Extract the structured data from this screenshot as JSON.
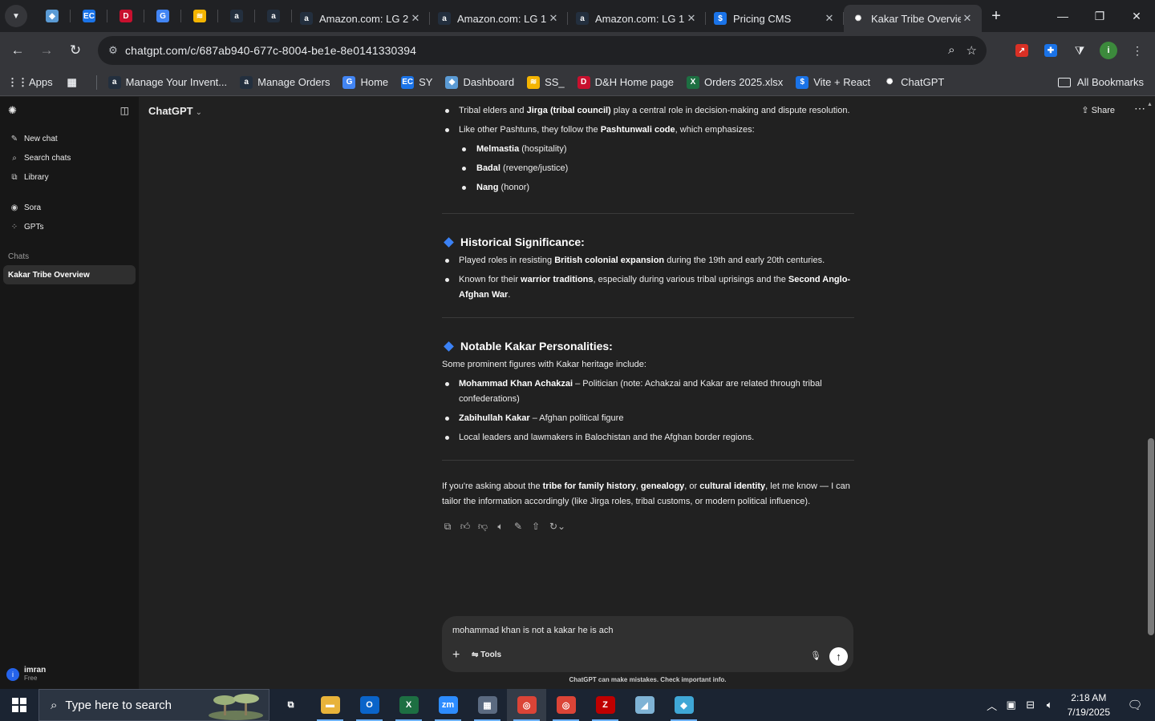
{
  "browser": {
    "pinned_tabs": [
      {
        "icon": "diamond-app-icon",
        "color": "#5b9bd5",
        "glyph": "◆"
      },
      {
        "icon": "ec-icon",
        "color": "#1a73e8",
        "glyph": "EC"
      },
      {
        "icon": "dh-icon",
        "color": "#c8102e",
        "glyph": "D"
      },
      {
        "icon": "g-blue-icon",
        "color": "#4285f4",
        "glyph": "G"
      },
      {
        "icon": "stack-icon",
        "color": "#f4b400",
        "glyph": "≋"
      },
      {
        "icon": "amazon-icon",
        "color": "#232f3e",
        "glyph": "a"
      },
      {
        "icon": "amazon-icon",
        "color": "#232f3e",
        "glyph": "a"
      }
    ],
    "tabs": [
      {
        "title": "Amazon.com: LG 2",
        "icon": "amazon-icon",
        "color": "#232f3e",
        "glyph": "a"
      },
      {
        "title": "Amazon.com: LG 1",
        "icon": "amazon-icon",
        "color": "#232f3e",
        "glyph": "a"
      },
      {
        "title": "Amazon.com: LG 1",
        "icon": "amazon-icon",
        "color": "#232f3e",
        "glyph": "a"
      },
      {
        "title": "Pricing CMS",
        "icon": "dollar-icon",
        "color": "#1a73e8",
        "glyph": "$"
      },
      {
        "title": "Kakar Tribe Overvie",
        "icon": "chatgpt-icon",
        "color": "#35363a",
        "glyph": "✺",
        "active": true
      }
    ],
    "url": "chatgpt.com/c/687ab940-677c-8004-be1e-8e0141330394",
    "bookmarks": [
      {
        "label": "Apps",
        "icon": "apps-grid-icon",
        "color": "#e8eaed",
        "glyph": "⋮⋮"
      },
      {
        "label": "",
        "icon": "tab-groups-icon",
        "color": "#e8eaed",
        "glyph": "▦"
      },
      {
        "label": "Manage Your Invent...",
        "icon": "amazon-icon",
        "color": "#232f3e",
        "glyph": "a"
      },
      {
        "label": "Manage Orders",
        "icon": "amazon-icon",
        "color": "#232f3e",
        "glyph": "a"
      },
      {
        "label": "Home",
        "icon": "g-blue-icon",
        "color": "#4285f4",
        "glyph": "G"
      },
      {
        "label": "SY",
        "icon": "ec-icon",
        "color": "#1a73e8",
        "glyph": "EC"
      },
      {
        "label": "Dashboard",
        "icon": "diamond-app-icon",
        "color": "#5b9bd5",
        "glyph": "◆"
      },
      {
        "label": "SS_",
        "icon": "stack-icon",
        "color": "#f4b400",
        "glyph": "≋"
      },
      {
        "label": "D&H Home page",
        "icon": "dh-icon",
        "color": "#c8102e",
        "glyph": "D"
      },
      {
        "label": "Orders 2025.xlsx",
        "icon": "excel-icon",
        "color": "#1d6f42",
        "glyph": "X"
      },
      {
        "label": "Vite + React",
        "icon": "dollar-icon",
        "color": "#1a73e8",
        "glyph": "$"
      },
      {
        "label": "ChatGPT",
        "icon": "chatgpt-icon",
        "color": "#35363a",
        "glyph": "✺"
      }
    ],
    "all_bookmarks": "All Bookmarks"
  },
  "sidebar": {
    "nav": [
      {
        "label": "New chat",
        "icon": "compose-icon",
        "glyph": "✎"
      },
      {
        "label": "Search chats",
        "icon": "search-icon",
        "glyph": "⌕"
      },
      {
        "label": "Library",
        "icon": "library-icon",
        "glyph": "⧉"
      }
    ],
    "nav2": [
      {
        "label": "Sora",
        "icon": "sora-icon",
        "glyph": "◉"
      },
      {
        "label": "GPTs",
        "icon": "gpts-icon",
        "glyph": "⁘"
      }
    ],
    "chats_label": "Chats",
    "active_chat": "Kakar Tribe Overview",
    "user": {
      "name": "imran",
      "plan": "Free",
      "initial": "i"
    }
  },
  "header": {
    "model": "ChatGPT",
    "share": "Share"
  },
  "message": {
    "top_bullets": [
      [
        {
          "t": "Tribal elders and "
        },
        {
          "b": "Jirga (tribal council)"
        },
        {
          "t": " play a central role in decision-making and dispute resolution."
        }
      ],
      [
        {
          "t": "Like other Pashtuns, they follow the "
        },
        {
          "b": "Pashtunwali code"
        },
        {
          "t": ", which emphasizes:"
        }
      ]
    ],
    "sub_bullets": [
      [
        {
          "b": "Melmastia"
        },
        {
          "t": " (hospitality)"
        }
      ],
      [
        {
          "b": "Badal"
        },
        {
          "t": " (revenge/justice)"
        }
      ],
      [
        {
          "b": "Nang"
        },
        {
          "t": " (honor)"
        }
      ]
    ],
    "section1_title": "Historical Significance:",
    "section1_bullets": [
      [
        {
          "t": "Played roles in resisting "
        },
        {
          "b": "British colonial expansion"
        },
        {
          "t": " during the 19th and early 20th centuries."
        }
      ],
      [
        {
          "t": "Known for their "
        },
        {
          "b": "warrior traditions"
        },
        {
          "t": ", especially during various tribal uprisings and the "
        },
        {
          "b": "Second Anglo-Afghan War"
        },
        {
          "t": "."
        }
      ]
    ],
    "section2_title": "Notable Kakar Personalities:",
    "section2_intro": "Some prominent figures with Kakar heritage include:",
    "section2_bullets": [
      [
        {
          "b": "Mohammad Khan Achakzai"
        },
        {
          "t": " – Politician (note: Achakzai and Kakar are related through tribal confederations)"
        }
      ],
      [
        {
          "b": "Zabihullah Kakar"
        },
        {
          "t": " – Afghan political figure"
        }
      ],
      [
        {
          "t": "Local leaders and lawmakers in Balochistan and the Afghan border regions."
        }
      ]
    ],
    "closing": [
      {
        "t": "If you're asking about the "
      },
      {
        "b": "tribe for family history"
      },
      {
        "t": ", "
      },
      {
        "b": "genealogy"
      },
      {
        "t": ", or "
      },
      {
        "b": "cultural identity"
      },
      {
        "t": ", let me know — I can tailor the information accordingly (like Jirga roles, tribal customs, or modern political influence)."
      }
    ]
  },
  "composer": {
    "text": "mohammad khan is not a kakar  he is ach",
    "tools_label": "Tools",
    "disclaimer": "ChatGPT can make mistakes. Check important info."
  },
  "taskbar": {
    "search_placeholder": "Type here to search",
    "apps": [
      {
        "icon": "task-view-icon",
        "color": "#1b2432",
        "glyph": "⧉"
      },
      {
        "icon": "file-explorer-icon",
        "color": "#e8b33a",
        "glyph": "▬",
        "running": true
      },
      {
        "icon": "outlook-icon",
        "color": "#0a64c9",
        "glyph": "O",
        "running": true
      },
      {
        "icon": "excel-icon",
        "color": "#1d6f42",
        "glyph": "X",
        "running": true
      },
      {
        "icon": "zoom-icon",
        "color": "#2d8cff",
        "glyph": "zm",
        "running": true
      },
      {
        "icon": "calculator-icon",
        "color": "#5b6a80",
        "glyph": "▦",
        "running": true
      },
      {
        "icon": "chrome-icon",
        "color": "#db4437",
        "glyph": "◎",
        "running": true,
        "active": true
      },
      {
        "icon": "chrome-icon",
        "color": "#db4437",
        "glyph": "◎",
        "running": true
      },
      {
        "icon": "filezilla-icon",
        "color": "#bf0000",
        "glyph": "Z",
        "running": true
      },
      {
        "icon": "notes-icon",
        "color": "#7fb3d5",
        "glyph": "◢"
      },
      {
        "icon": "diamond-app-icon",
        "color": "#3fa7d6",
        "glyph": "◆",
        "running": true
      }
    ],
    "time": "2:18 AM",
    "date": "7/19/2025"
  }
}
